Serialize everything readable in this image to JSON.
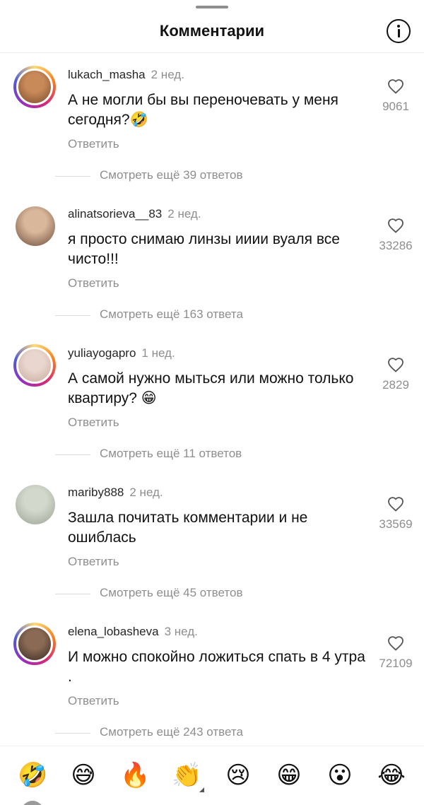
{
  "header": {
    "title": "Комментарии"
  },
  "comments": [
    {
      "username": "lukach_masha",
      "time": "2 нед.",
      "text": "А не могли бы вы переночевать у меня сегодня?🤣",
      "reply": "Ответить",
      "likes": "9061",
      "more": "Смотреть ещё 39 ответов",
      "story_ring": true,
      "avatar_colors": [
        "#c98a5a",
        "#7a4a2a"
      ]
    },
    {
      "username": "alinatsorieva__83",
      "time": "2 нед.",
      "text": "я просто снимаю линзы ииии вуаля все чисто!!!",
      "reply": "Ответить",
      "likes": "33286",
      "more": "Смотреть ещё 163 ответа",
      "story_ring": false,
      "avatar_colors": [
        "#d9b79a",
        "#6b4a3a"
      ]
    },
    {
      "username": "yuliayogapro",
      "time": "1 нед.",
      "text": "А самой нужно мыться или можно только квартиру? 😁",
      "reply": "Ответить",
      "likes": "2829",
      "more": "Смотреть ещё 11 ответов",
      "story_ring": true,
      "avatar_colors": [
        "#e9d7cf",
        "#c7a99b"
      ]
    },
    {
      "username": "mariby888",
      "time": "2 нед.",
      "text": "Зашла почитать комментарии и не ошиблась",
      "reply": "Ответить",
      "likes": "33569",
      "more": "Смотреть ещё 45 ответов",
      "story_ring": false,
      "avatar_colors": [
        "#d3d8cc",
        "#9aa394"
      ]
    },
    {
      "username": "elena_lobasheva",
      "time": "3 нед.",
      "text": "И можно спокойно ложиться спать в 4 утра .",
      "reply": "Ответить",
      "likes": "72109",
      "more": "Смотреть ещё 243 ответа",
      "story_ring": true,
      "avatar_colors": [
        "#8a6a55",
        "#3a2a22"
      ]
    }
  ],
  "emoji_bar": [
    "🤣",
    "😅",
    "🔥",
    "👏",
    "😢",
    "😁",
    "😮",
    "😂"
  ],
  "colors": {
    "secondary_text": "#8e8e8e",
    "divider": "#efefef"
  }
}
